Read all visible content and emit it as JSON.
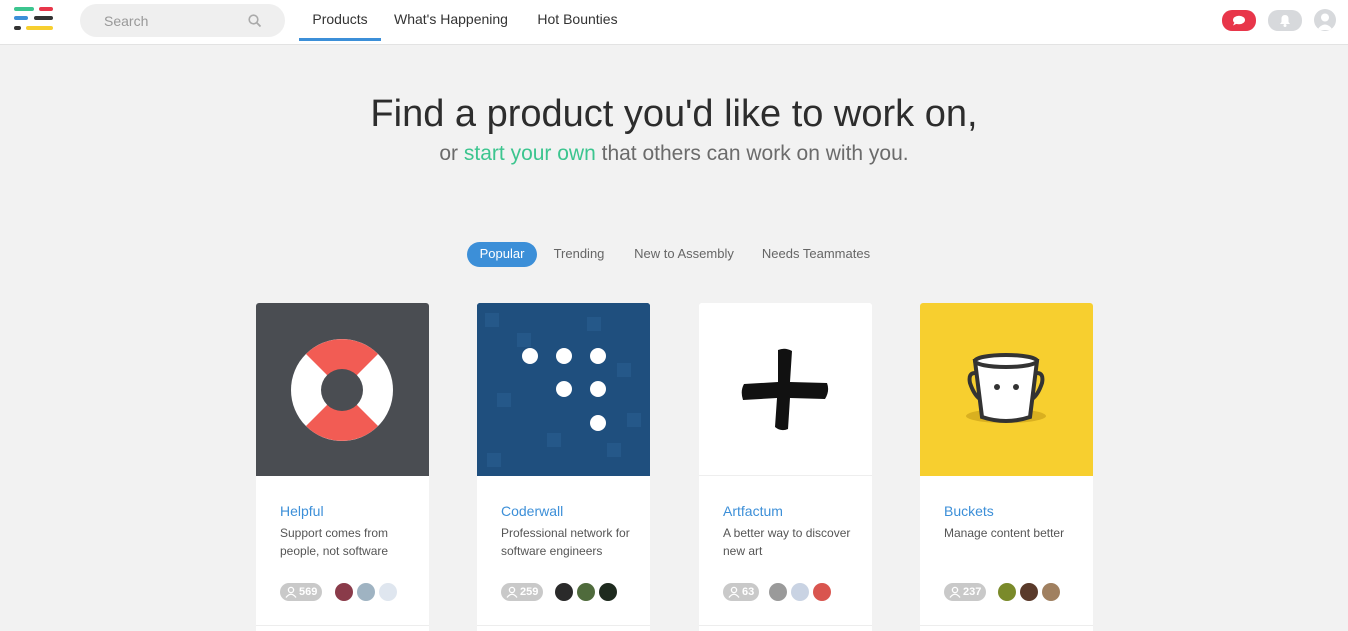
{
  "header": {
    "search_placeholder": "Search",
    "nav": [
      {
        "label": "Products",
        "active": true
      },
      {
        "label": "What's Happening",
        "active": false
      },
      {
        "label": "Hot Bounties",
        "active": false
      }
    ],
    "icons": [
      "chat-icon",
      "bell-icon",
      "user-avatar"
    ]
  },
  "hero": {
    "title": "Find a product you'd like to work on,",
    "sub_prefix": "or ",
    "sub_link": "start your own",
    "sub_suffix": " that others can work on with you."
  },
  "filters": [
    {
      "label": "Popular",
      "active": true
    },
    {
      "label": "Trending",
      "active": false
    },
    {
      "label": "New to Assembly",
      "active": false
    },
    {
      "label": "Needs Teammates",
      "active": false
    }
  ],
  "products": [
    {
      "name": "Helpful",
      "description": "Support comes from people, not software",
      "members": "569",
      "logo": "lifebuoy-icon",
      "bg": "#4a4d52"
    },
    {
      "name": "Coderwall",
      "description": "Professional network for software engineers",
      "members": "259",
      "logo": "dots-icon",
      "bg": "#1f4f7e"
    },
    {
      "name": "Artfactum",
      "description": "A better way to discover new art",
      "members": "63",
      "logo": "plus-icon",
      "bg": "#ffffff"
    },
    {
      "name": "Buckets",
      "description": "Manage content better",
      "members": "237",
      "logo": "bucket-icon",
      "bg": "#f7cf2f"
    }
  ],
  "colors": {
    "accent": "#3c8fd8",
    "link_green": "#3cc58f",
    "chat_red": "#e8364a"
  }
}
